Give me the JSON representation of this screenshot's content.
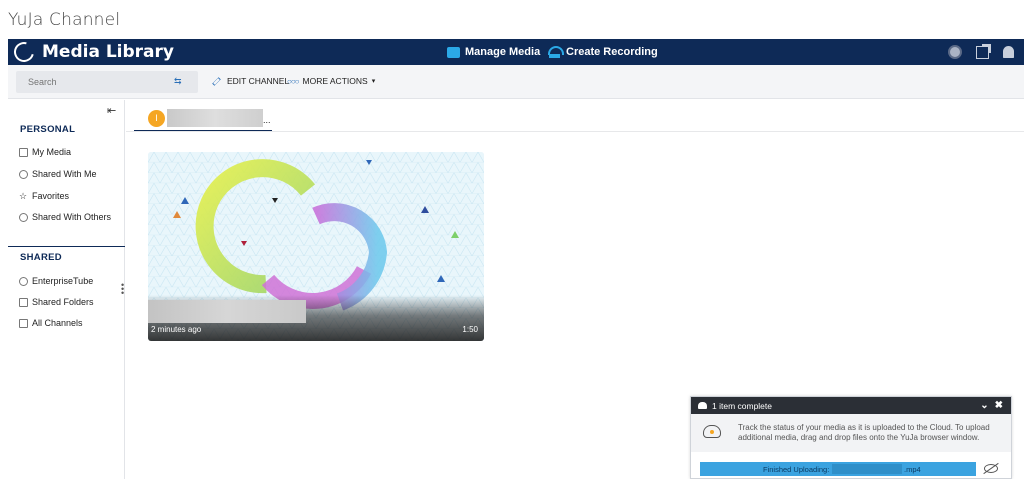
{
  "page": {
    "title": "YuJa Channel"
  },
  "topbar": {
    "brand": "Media Library",
    "manage_media": "Manage Media",
    "create_recording": "Create Recording",
    "icons": [
      "user-circle-icon",
      "external-link-icon",
      "bell-icon"
    ]
  },
  "toolbar": {
    "search_placeholder": "Search",
    "edit_channel": "EDIT CHANNEL",
    "more_actions": "MORE ACTIONS",
    "more_actions_caret": "▾"
  },
  "sidebar": {
    "collapse_glyph": "⇤",
    "personal_heading": "PERSONAL",
    "personal_items": [
      {
        "label": "My Media",
        "icon": "home-icon"
      },
      {
        "label": "Shared With Me",
        "icon": "share-icon"
      },
      {
        "label": "Favorites",
        "icon": "star-icon"
      },
      {
        "label": "Shared With Others",
        "icon": "users-icon"
      }
    ],
    "shared_heading": "SHARED",
    "shared_items": [
      {
        "label": "EnterpriseTube",
        "icon": "globe-icon"
      },
      {
        "label": "Shared Folders",
        "icon": "folder-icon"
      },
      {
        "label": "All Channels",
        "icon": "channels-icon"
      }
    ]
  },
  "channel": {
    "avatar_letter": "I",
    "ellipsis": "..."
  },
  "media": [
    {
      "uploaded": "2 minutes ago",
      "duration": "1:50"
    }
  ],
  "upload": {
    "header": "1 item complete",
    "collapse": "⌄",
    "close": "✖",
    "message": "Track the status of your media as it is uploaded to the Cloud. To upload additional media, drag and drop files onto the YuJa browser window.",
    "status": "Finished Uploading:",
    "file_ext": ".mp4",
    "progress": 1.0
  },
  "colors": {
    "navy": "#0e2a57",
    "accent_blue": "#2ba9e7",
    "progress_blue": "#3ba3e0",
    "avatar_orange": "#f5a623"
  }
}
